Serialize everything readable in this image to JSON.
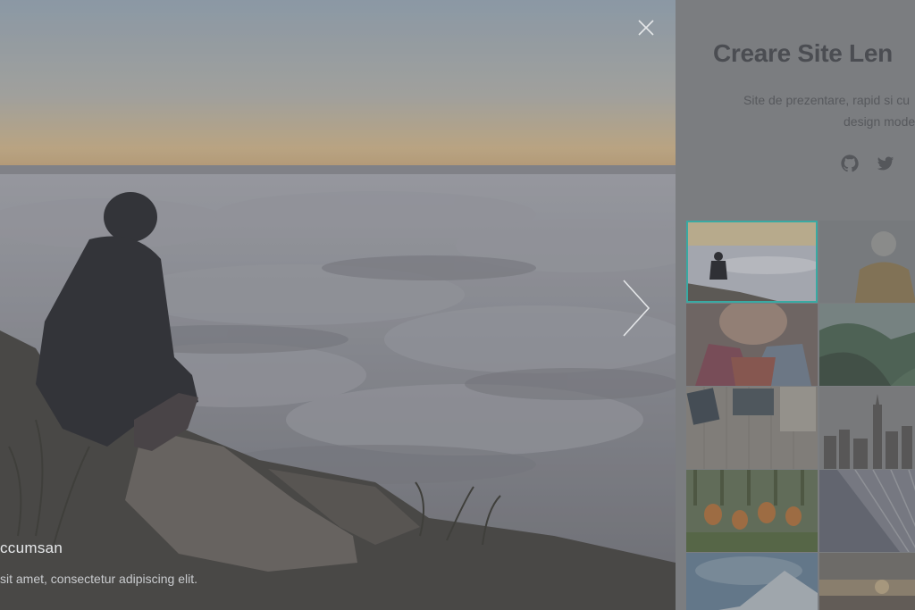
{
  "viewer": {
    "caption_title": "ccumsan",
    "caption_text": "sit amet, consectetur adipiscing elit.",
    "close_icon": "close-icon",
    "next_icon": "chevron-right-icon"
  },
  "panel": {
    "title": "Creare Site Len",
    "subtitle_line1": "Site de prezentare, rapid si cu",
    "subtitle_line2": "design mode",
    "social_icons": [
      "github-icon",
      "twitter-icon"
    ],
    "thumbnails": [
      {
        "name": "thumb-clouds-man",
        "active": true
      },
      {
        "name": "thumb-hiker-hat",
        "active": false
      },
      {
        "name": "thumb-woman-scarf",
        "active": false
      },
      {
        "name": "thumb-green-valley",
        "active": false
      },
      {
        "name": "thumb-desk-typewriter",
        "active": false
      },
      {
        "name": "thumb-city-skyline",
        "active": false
      },
      {
        "name": "thumb-tulips",
        "active": false
      },
      {
        "name": "thumb-building-glass",
        "active": false
      },
      {
        "name": "thumb-snow-mountain",
        "active": false
      },
      {
        "name": "thumb-sunset-field",
        "active": false
      }
    ]
  },
  "colors": {
    "accent": "#3aa9a2",
    "panel_bg": "#7b7d80",
    "title": "#4b4d52"
  }
}
